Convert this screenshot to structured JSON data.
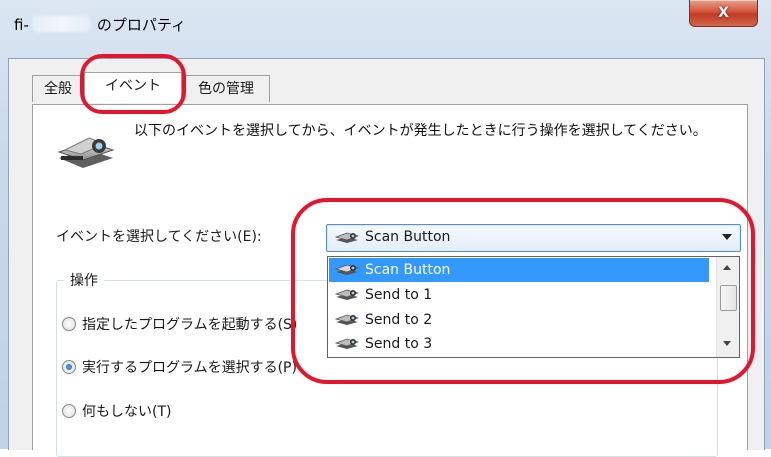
{
  "window": {
    "title_prefix": "fi-",
    "title_suffix": "のプロパティ",
    "close_glyph": "X"
  },
  "tabs": [
    {
      "label": "全般"
    },
    {
      "label": "イベント"
    },
    {
      "label": "色の管理"
    }
  ],
  "events": {
    "description": "以下のイベントを選択してから、イベントが発生したときに行う操作を選択してください。",
    "select_label": "イベントを選択してください(E):",
    "selected_event": "Scan Button",
    "options": [
      "Scan Button",
      "Send to 1",
      "Send to 2",
      "Send to 3"
    ]
  },
  "actions": {
    "title": "操作",
    "options": [
      {
        "label": "指定したプログラムを起動する(S)",
        "checked": false
      },
      {
        "label": "実行するプログラムを選択する(P)",
        "checked": true
      },
      {
        "label": "何もしない(T)",
        "checked": false
      }
    ]
  },
  "colors": {
    "annotation": "#e4162b",
    "selection": "#3399ff"
  }
}
